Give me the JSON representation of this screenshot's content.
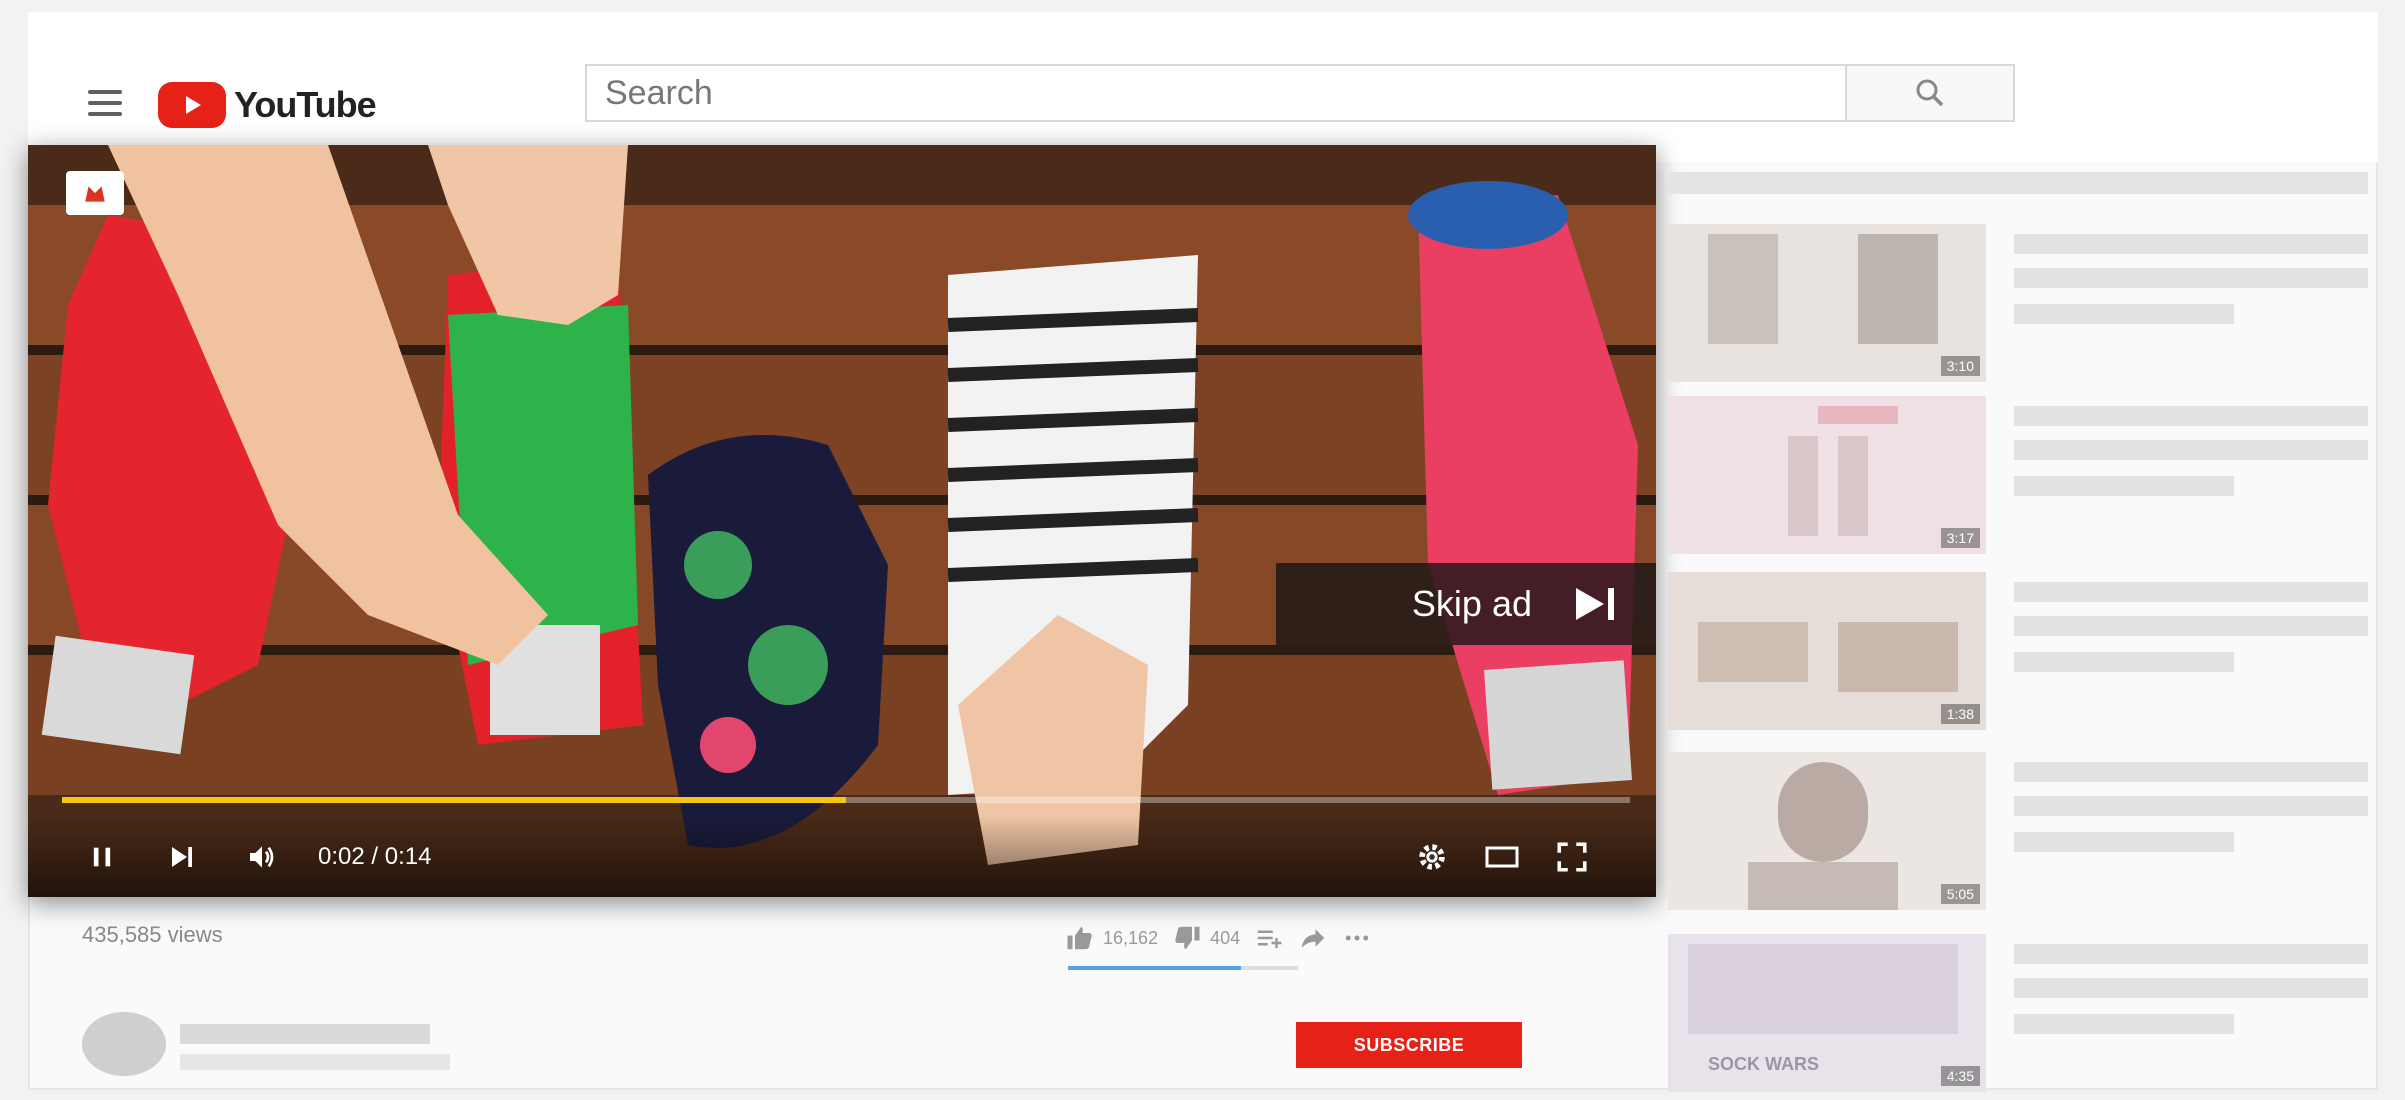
{
  "masthead": {
    "logo_text": "YouTube",
    "search_placeholder": "Search"
  },
  "player": {
    "skip_label": "Skip ad",
    "time_current": "0:02",
    "time_separator": " / ",
    "time_total": "0:14",
    "progress": 0.5,
    "accent_color": "#f6c516"
  },
  "video_info": {
    "views": "435,585 views",
    "likes": "16,162",
    "dislikes": "404",
    "subscribe_label": "SUBSCRIBE"
  },
  "sidebar": {
    "items": [
      {
        "duration": "3:10"
      },
      {
        "duration": "3:17"
      },
      {
        "duration": "1:38"
      },
      {
        "duration": "5:05"
      },
      {
        "duration": "4:35",
        "thumb_text": "SOCK WARS"
      }
    ]
  },
  "colors": {
    "brand_red": "#e62117",
    "progress_yellow": "#f6c516"
  }
}
